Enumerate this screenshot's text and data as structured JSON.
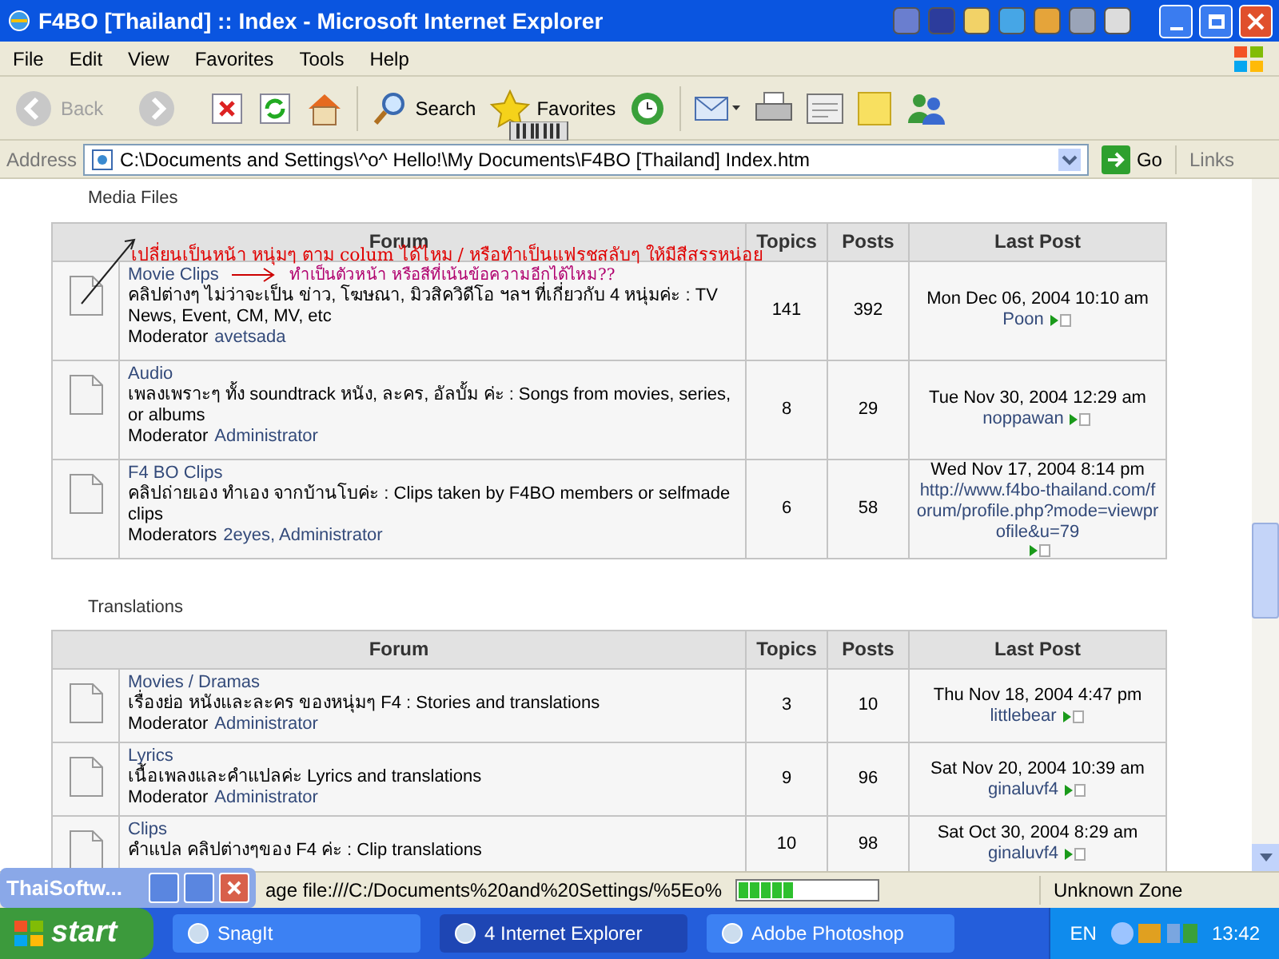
{
  "window": {
    "title": "F4BO [Thailand] :: Index - Microsoft Internet Explorer"
  },
  "menu": [
    "File",
    "Edit",
    "View",
    "Favorites",
    "Tools",
    "Help"
  ],
  "toolbar": [
    {
      "label": "Back",
      "disabled": true
    },
    {
      "label": "Search",
      "disabled": false
    },
    {
      "label": "Favorites",
      "disabled": false
    }
  ],
  "address": {
    "label": "Address",
    "value": "C:\\Documents and Settings\\^o^ Hello!\\My Documents\\F4BO [Thailand]  Index.htm",
    "go": "Go",
    "links": "Links"
  },
  "sections": [
    {
      "title": "Media Files",
      "columns": [
        "Forum",
        "Topics",
        "Posts",
        "Last Post"
      ],
      "rows": [
        {
          "title": "Movie Clips",
          "description": "คลิปต่างๆ ไม่ว่าจะเป็น ข่าว, โฆษณา, มิวสิควิดีโอ ฯลฯ ที่เกี่ยวกับ 4 หนุ่มค่ะ : TV News, Event, CM, MV, etc",
          "moderator_label": "Moderator",
          "moderators": "avetsada",
          "topics": "141",
          "posts": "392",
          "last_post_date": "Mon Dec 06, 2004 10:10 am",
          "last_post_user": "Poon"
        },
        {
          "title": "Audio",
          "description": "เพลงเพราะๆ ทั้ง soundtrack หนัง, ละคร, อัลบั้ม ค่ะ : Songs from movies, series, or albums",
          "moderator_label": "Moderator",
          "moderators": "Administrator",
          "topics": "8",
          "posts": "29",
          "last_post_date": "Tue Nov 30, 2004 12:29 am",
          "last_post_user": "noppawan"
        },
        {
          "title": "F4 BO Clips",
          "description": "คลิปถ่ายเอง ทำเอง จากบ้านโบค่ะ : Clips taken by F4BO members or selfmade clips",
          "moderator_label": "Moderators",
          "moderators": "2eyes, Administrator",
          "topics": "6",
          "posts": "58",
          "last_post_date": "Wed Nov 17, 2004 8:14 pm",
          "last_post_user": "http://www.f4bo-thailand.com/forum/profile.php?mode=viewprofile&u=79"
        }
      ]
    },
    {
      "title": "Translations",
      "columns": [
        "Forum",
        "Topics",
        "Posts",
        "Last Post"
      ],
      "rows": [
        {
          "title": "Movies / Dramas",
          "description": "เรื่องย่อ หนังและละคร ของหนุ่มๆ F4 : Stories and translations",
          "moderator_label": "Moderator",
          "moderators": "Administrator",
          "topics": "3",
          "posts": "10",
          "last_post_date": "Thu Nov 18, 2004 4:47 pm",
          "last_post_user": "littlebear"
        },
        {
          "title": "Lyrics",
          "description": "เนื้อเพลงและคำแปลค่ะ Lyrics and translations",
          "moderator_label": "Moderator",
          "moderators": "Administrator",
          "topics": "9",
          "posts": "96",
          "last_post_date": "Sat Nov 20, 2004 10:39 am",
          "last_post_user": "ginaluvf4"
        },
        {
          "title": "Clips",
          "description": "คำแปล คลิปต่างๆของ F4 ค่ะ : Clip translations",
          "topics": "10",
          "posts": "98",
          "last_post_date": "Sat Oct 30, 2004 8:29 am",
          "last_post_user": "ginaluvf4"
        }
      ]
    }
  ],
  "annotations": [
    {
      "text": "เปลี่ยนเป็นหน้า หนุ่มๆ ตาม colum ได้ไหม / หรือทำเป็นแฟรชสลับๆ ให้มีสีสรรหน่อย",
      "color": "#e00000"
    },
    {
      "text": "ทำเป็นตัวหน้า หรือสีที่เน้นข้อความอีกได้ไหม??",
      "color": "#b0006e"
    }
  ],
  "floating_window": {
    "title": "ThaiSoftw..."
  },
  "status_bar": {
    "text": "age file:///C:/Documents%20and%20Settings/%5Eo%",
    "level": 0.4,
    "zone": "Unknown Zone"
  },
  "taskbar": {
    "start": "start",
    "tasks": [
      {
        "label": "SnagIt",
        "selected": false
      },
      {
        "label": "4  Internet Explorer",
        "selected": true
      },
      {
        "label": "Adobe Photoshop",
        "selected": false
      }
    ],
    "language": "EN",
    "clock": "13:42"
  }
}
